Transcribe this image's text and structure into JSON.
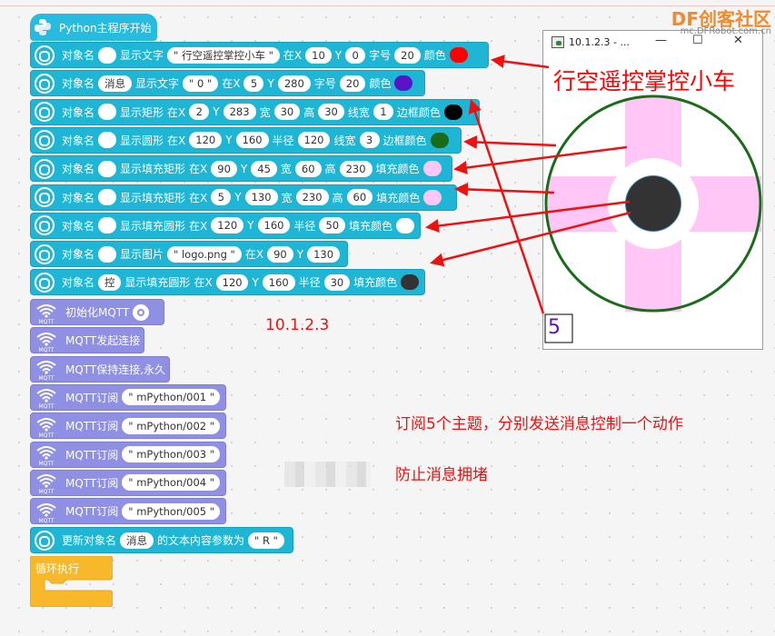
{
  "program": {
    "hat_label": "Python主程序开始",
    "obj_blocks": [
      {
        "obj": "对象名",
        "name": "",
        "action": "显示文字",
        "args": [
          {
            "l": "",
            "v": "\" 行空遥控掌控小车 \""
          },
          {
            "l": "在X",
            "v": "10"
          },
          {
            "l": "Y",
            "v": "0"
          },
          {
            "l": "字号",
            "v": "20"
          },
          {
            "l": "颜色",
            "c": "#ff0000"
          }
        ]
      },
      {
        "obj": "对象名",
        "name": "消息",
        "action": "显示文字",
        "args": [
          {
            "l": "",
            "v": "\" 0 \""
          },
          {
            "l": "在X",
            "v": "5"
          },
          {
            "l": "Y",
            "v": "280"
          },
          {
            "l": "字号",
            "v": "20"
          },
          {
            "l": "颜色",
            "c": "#5b13c9"
          }
        ]
      },
      {
        "obj": "对象名",
        "name": "",
        "action": "显示矩形",
        "args": [
          {
            "l": "在X",
            "v": "2"
          },
          {
            "l": "Y",
            "v": "283"
          },
          {
            "l": "宽",
            "v": "30"
          },
          {
            "l": "高",
            "v": "30"
          },
          {
            "l": "线宽",
            "v": "1"
          },
          {
            "l": "边框颜色",
            "c": "#000000"
          }
        ]
      },
      {
        "obj": "对象名",
        "name": "",
        "action": "显示圆形",
        "args": [
          {
            "l": "在X",
            "v": "120"
          },
          {
            "l": "Y",
            "v": "160"
          },
          {
            "l": "半径",
            "v": "120"
          },
          {
            "l": "线宽",
            "v": "3"
          },
          {
            "l": "边框颜色",
            "c": "#1a6b1a"
          }
        ]
      },
      {
        "obj": "对象名",
        "name": "",
        "action": "显示填充矩形",
        "args": [
          {
            "l": "在X",
            "v": "90"
          },
          {
            "l": "Y",
            "v": "45"
          },
          {
            "l": "宽",
            "v": "60"
          },
          {
            "l": "高",
            "v": "230"
          },
          {
            "l": "填充颜色",
            "c": "#ffc6f6"
          }
        ]
      },
      {
        "obj": "对象名",
        "name": "",
        "action": "显示填充矩形",
        "args": [
          {
            "l": "在X",
            "v": "5"
          },
          {
            "l": "Y",
            "v": "130"
          },
          {
            "l": "宽",
            "v": "230"
          },
          {
            "l": "高",
            "v": "60"
          },
          {
            "l": "填充颜色",
            "c": "#ffc6f6"
          }
        ]
      },
      {
        "obj": "对象名",
        "name": "",
        "action": "显示填充圆形",
        "args": [
          {
            "l": "在X",
            "v": "120"
          },
          {
            "l": "Y",
            "v": "160"
          },
          {
            "l": "半径",
            "v": "50"
          },
          {
            "l": "填充颜色",
            "c": "#ffffff"
          }
        ]
      },
      {
        "obj": "对象名",
        "name": "",
        "action": "显示图片",
        "args": [
          {
            "l": "",
            "v": "\" logo.png \""
          },
          {
            "l": "在X",
            "v": "90"
          },
          {
            "l": "Y",
            "v": "130"
          }
        ]
      },
      {
        "obj": "对象名",
        "name": "控",
        "action": "显示填充圆形",
        "args": [
          {
            "l": "在X",
            "v": "120"
          },
          {
            "l": "Y",
            "v": "160"
          },
          {
            "l": "半径",
            "v": "30"
          },
          {
            "l": "填充颜色",
            "c": "#333333"
          }
        ]
      }
    ],
    "mqtt_blocks": [
      {
        "label": "初始化MQTT",
        "gear": true,
        "icon_text": "MQTT"
      },
      {
        "label": "MQTT发起连接",
        "icon_text": "MQTT"
      },
      {
        "label": "MQTT保持连接,永久",
        "icon_text": "MQTT"
      },
      {
        "label": "MQTT订阅",
        "arg": "\" mPython/001 \"",
        "icon_text": "MQTT"
      },
      {
        "label": "MQTT订阅",
        "arg": "\" mPython/002 \"",
        "icon_text": "MQTT"
      },
      {
        "label": "MQTT订阅",
        "arg": "\" mPython/003 \"",
        "icon_text": "MQTT"
      },
      {
        "label": "MQTT订阅",
        "arg": "\" mPython/004 \"",
        "icon_text": "MQTT"
      },
      {
        "label": "MQTT订阅",
        "arg": "\" mPython/005 \"",
        "icon_text": "MQTT"
      }
    ],
    "update_block": {
      "prefix": "更新对象名",
      "name": "消息",
      "middle": "的文本内容参数为",
      "value": "\" R \""
    },
    "loop_label": "循环执行"
  },
  "window": {
    "title": "10.1.2.3 - ...",
    "minimize": "—",
    "maximize": "☐",
    "close": "✕",
    "screen_text": "行空遥控掌控小车",
    "counter": "5",
    "colors": {
      "ring": "#1a6b1a",
      "cross": "#ffc6f6",
      "center": "#333333",
      "text": "#ff0000",
      "counter": "#5b13c9"
    }
  },
  "annotations": {
    "ip": "10.1.2.3",
    "line1": "订阅5个主题，分别发送消息控制一个动作",
    "line2": "防止消息拥堵"
  },
  "watermark": {
    "brand": "DF创客社区",
    "url": "mc.DFRobot.com.cn"
  }
}
